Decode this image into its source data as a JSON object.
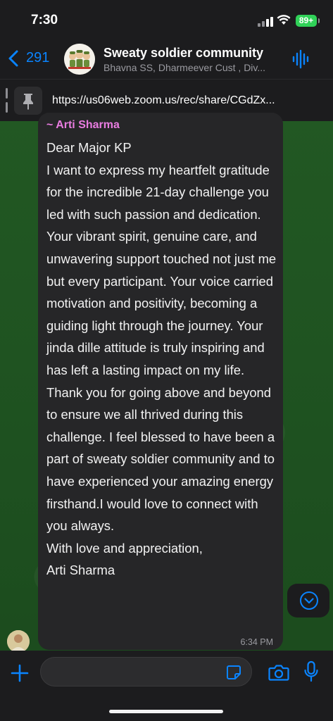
{
  "status_bar": {
    "time": "7:30",
    "battery": "89+"
  },
  "header": {
    "back_count": "291",
    "title": "Sweaty soldier community",
    "subtitle": "Bhavna SS, Dharmeever Cust , Div..."
  },
  "pinned": {
    "text": "https://us06web.zoom.us/rec/share/CGdZx..."
  },
  "message": {
    "sender": "~ Arti Sharma",
    "body": "Dear Major KP\nI want to express my heartfelt gratitude for the incredible 21-day challenge you led with such passion and dedication. Your vibrant spirit, genuine care, and unwavering support touched not just me but every participant. Your voice carried motivation and positivity, becoming a guiding light through the journey. Your jinda dille attitude is truly inspiring and has left a lasting impact on my life. Thank you for going above and beyond to ensure we all thrived during this challenge. I feel blessed to have been a part of sweaty soldier community and to have experienced your amazing energy firsthand.I would love to connect with you always.\nWith love and appreciation,\nArti Sharma",
    "time": "6:34 PM"
  },
  "input": {
    "value": "",
    "placeholder": ""
  },
  "colors": {
    "accent": "#0a84ff",
    "sender_name": "#e87ce0",
    "battery": "#30d158",
    "wallpaper": "#1f5321"
  },
  "icons": {
    "back": "chevron-left-icon",
    "voice": "audio-wave-icon",
    "pin": "pin-icon",
    "scroll": "chevron-down-circle-icon",
    "attach": "plus-icon",
    "sticker": "sticker-icon",
    "camera": "camera-icon",
    "mic": "microphone-icon"
  }
}
